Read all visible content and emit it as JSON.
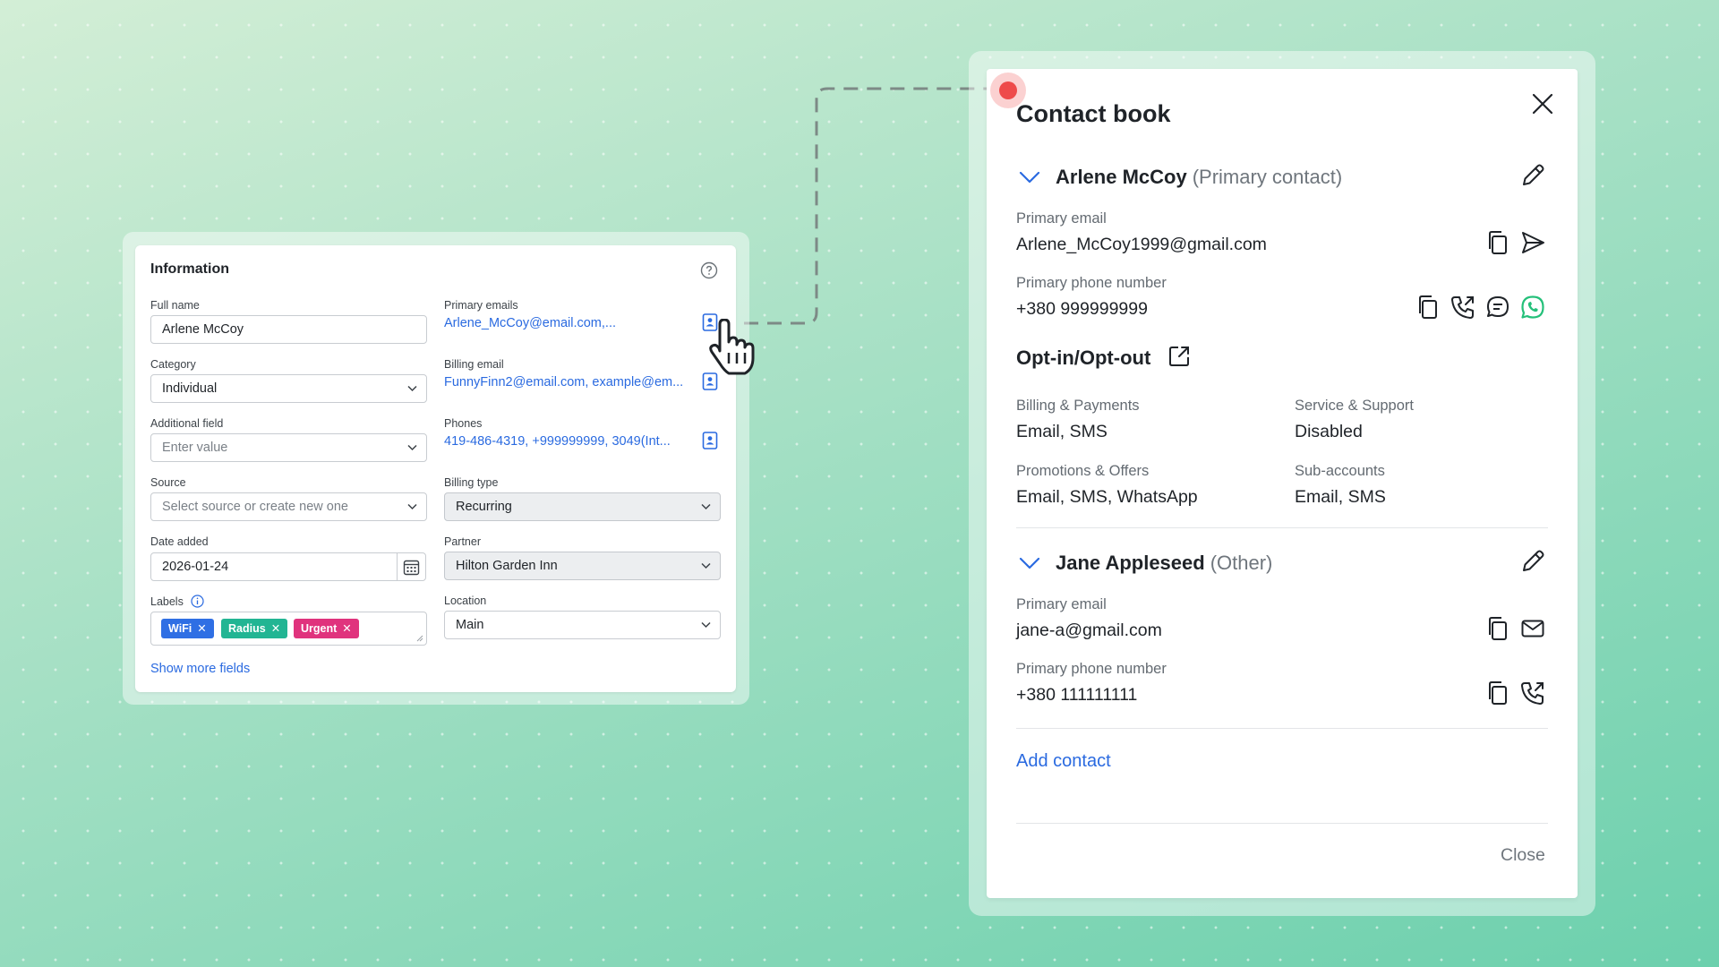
{
  "info": {
    "title": "Information",
    "full_name": {
      "label": "Full name",
      "value": "Arlene McCoy"
    },
    "category": {
      "label": "Category",
      "value": "Individual"
    },
    "additional_field": {
      "label": "Additional field",
      "placeholder": "Enter value"
    },
    "source": {
      "label": "Source",
      "placeholder": "Select source or create new one"
    },
    "date_added": {
      "label": "Date added",
      "value": "2026-01-24"
    },
    "labels": {
      "label": "Labels",
      "tags": [
        {
          "text": "WiFi",
          "color": "#2f6fe4"
        },
        {
          "text": "Radius",
          "color": "#22b593"
        },
        {
          "text": "Urgent",
          "color": "#e0337d"
        }
      ]
    },
    "primary_emails": {
      "label": "Primary emails",
      "value": "Arlene_McCoy@email.com,..."
    },
    "billing_email": {
      "label": "Billing email",
      "value": "FunnyFinn2@email.com, example@em..."
    },
    "phones": {
      "label": "Phones",
      "values": [
        "419-486-4319,",
        "+999999999,",
        "3049(Int..."
      ]
    },
    "billing_type": {
      "label": "Billing type",
      "value": "Recurring"
    },
    "partner": {
      "label": "Partner",
      "value": "Hilton Garden Inn"
    },
    "location": {
      "label": "Location",
      "value": "Main"
    },
    "show_more": "Show more fields"
  },
  "contact_book": {
    "title": "Contact book",
    "contacts": [
      {
        "name": "Arlene McCoy",
        "role": "(Primary contact)",
        "email_label": "Primary email",
        "email": "Arlene_McCoy1999@gmail.com",
        "phone_label": "Primary phone number",
        "phone": "+380 999999999"
      },
      {
        "name": "Jane Appleseed",
        "role": "(Other)",
        "email_label": "Primary email",
        "email": "jane-a@gmail.com",
        "phone_label": "Primary phone number",
        "phone": "+380 111111111"
      }
    ],
    "opt": {
      "title": "Opt-in/Opt-out",
      "items": [
        {
          "label": "Billing & Payments",
          "value": "Email, SMS"
        },
        {
          "label": "Service & Support",
          "value": "Disabled"
        },
        {
          "label": "Promotions & Offers",
          "value": "Email, SMS, WhatsApp"
        },
        {
          "label": "Sub-accounts",
          "value": "Email, SMS"
        }
      ]
    },
    "add_contact": "Add contact",
    "close": "Close"
  },
  "colors": {
    "link": "#2a6ae0",
    "whatsapp": "#25c07a",
    "cursor_dot": "#ee4b4b"
  }
}
